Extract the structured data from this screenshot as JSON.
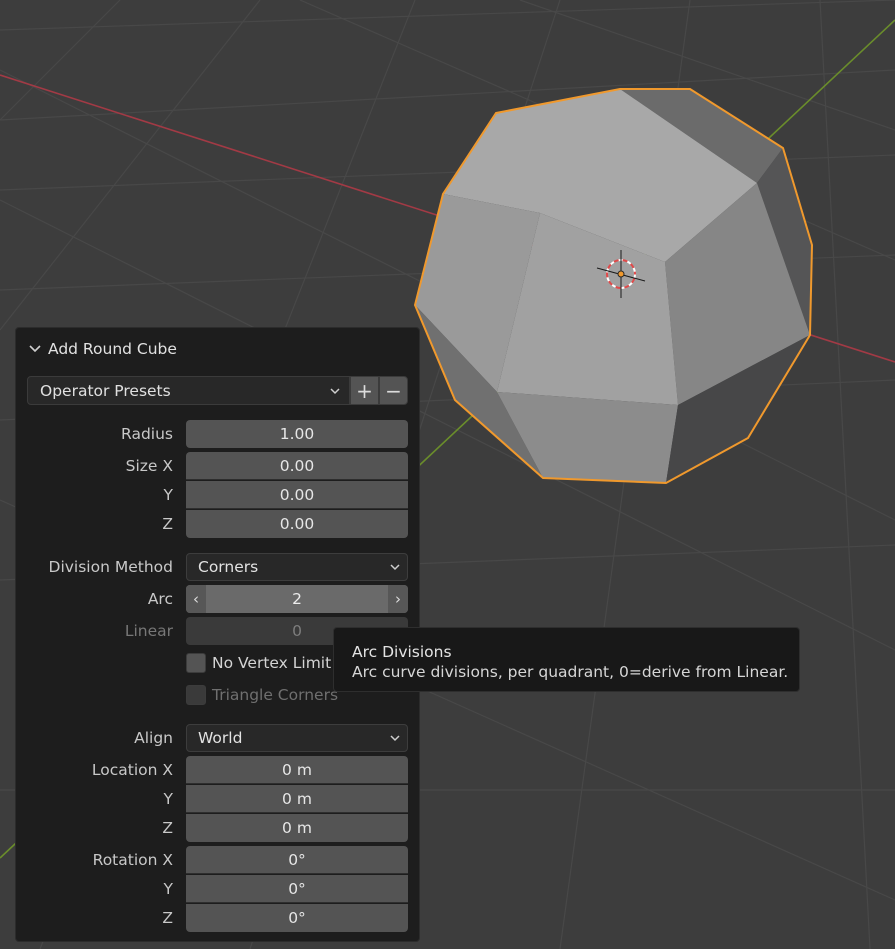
{
  "panel": {
    "title": "Add Round Cube",
    "presets": {
      "label": "Operator Presets",
      "add": "+",
      "remove": "−"
    },
    "radius": {
      "label": "Radius",
      "value": "1.00"
    },
    "size": {
      "label_x": "Size X",
      "label_y": "Y",
      "label_z": "Z",
      "x": "0.00",
      "y": "0.00",
      "z": "0.00"
    },
    "division_method": {
      "label": "Division Method",
      "value": "Corners"
    },
    "arc": {
      "label": "Arc",
      "value": "2",
      "left": "‹",
      "right": "›"
    },
    "linear": {
      "label": "Linear",
      "value": "0"
    },
    "no_vertex_limit": {
      "label": "No Vertex Limit",
      "checked": false
    },
    "triangle_corners": {
      "label": "Triangle Corners",
      "checked": false
    },
    "align": {
      "label": "Align",
      "value": "World"
    },
    "location": {
      "label_x": "Location X",
      "label_y": "Y",
      "label_z": "Z",
      "x": "0 m",
      "y": "0 m",
      "z": "0 m"
    },
    "rotation": {
      "label_x": "Rotation X",
      "label_y": "Y",
      "label_z": "Z",
      "x": "0°",
      "y": "0°",
      "z": "0°"
    }
  },
  "tooltip": {
    "title": "Arc Divisions",
    "description": "Arc curve divisions, per quadrant, 0=derive from Linear."
  },
  "colors": {
    "viewport_bg": "#3d3d3d",
    "selection_outline": "#f0992d",
    "x_axis": "#a23a45",
    "y_axis": "#6a8d2b"
  },
  "icons": [
    "chevron-down-icon",
    "plus-icon",
    "minus-icon",
    "3d-cursor-icon"
  ]
}
